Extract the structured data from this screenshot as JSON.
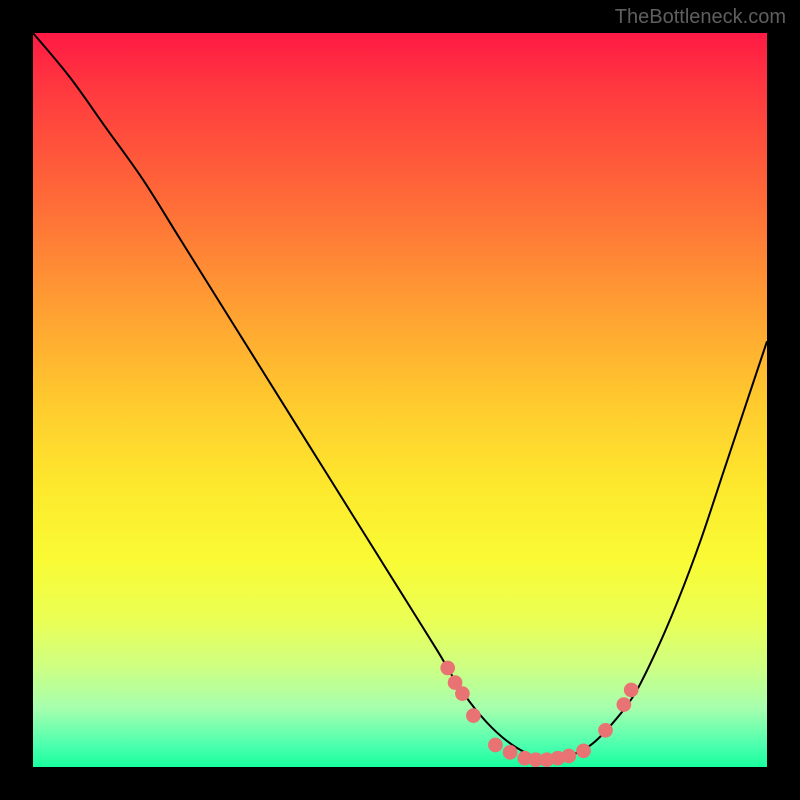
{
  "watermark": "TheBottleneck.com",
  "chart_data": {
    "type": "line",
    "title": "",
    "xlabel": "",
    "ylabel": "",
    "xlim": [
      0,
      100
    ],
    "ylim": [
      0,
      100
    ],
    "curve": {
      "x": [
        0,
        5,
        10,
        15,
        20,
        25,
        30,
        35,
        40,
        45,
        50,
        55,
        58,
        61,
        64,
        67,
        70,
        73,
        76,
        79,
        82,
        85,
        88,
        91,
        94,
        97,
        100
      ],
      "y": [
        100,
        94,
        87,
        80,
        72,
        64,
        56,
        48,
        40,
        32,
        24,
        16,
        11,
        7,
        4,
        2,
        1,
        1.5,
        3,
        6,
        10,
        16,
        23,
        31,
        40,
        49,
        58
      ]
    },
    "markers": {
      "x": [
        56.5,
        57.5,
        58.5,
        60.0,
        63.0,
        65.0,
        67.0,
        68.5,
        70.0,
        71.5,
        73.0,
        75.0,
        78.0,
        80.5,
        81.5
      ],
      "y": [
        13.5,
        11.5,
        10.0,
        7.0,
        3.0,
        2.0,
        1.2,
        1.0,
        1.0,
        1.2,
        1.5,
        2.2,
        5.0,
        8.5,
        10.5
      ]
    },
    "marker_color": "#e97373",
    "curve_color": "#000000"
  }
}
